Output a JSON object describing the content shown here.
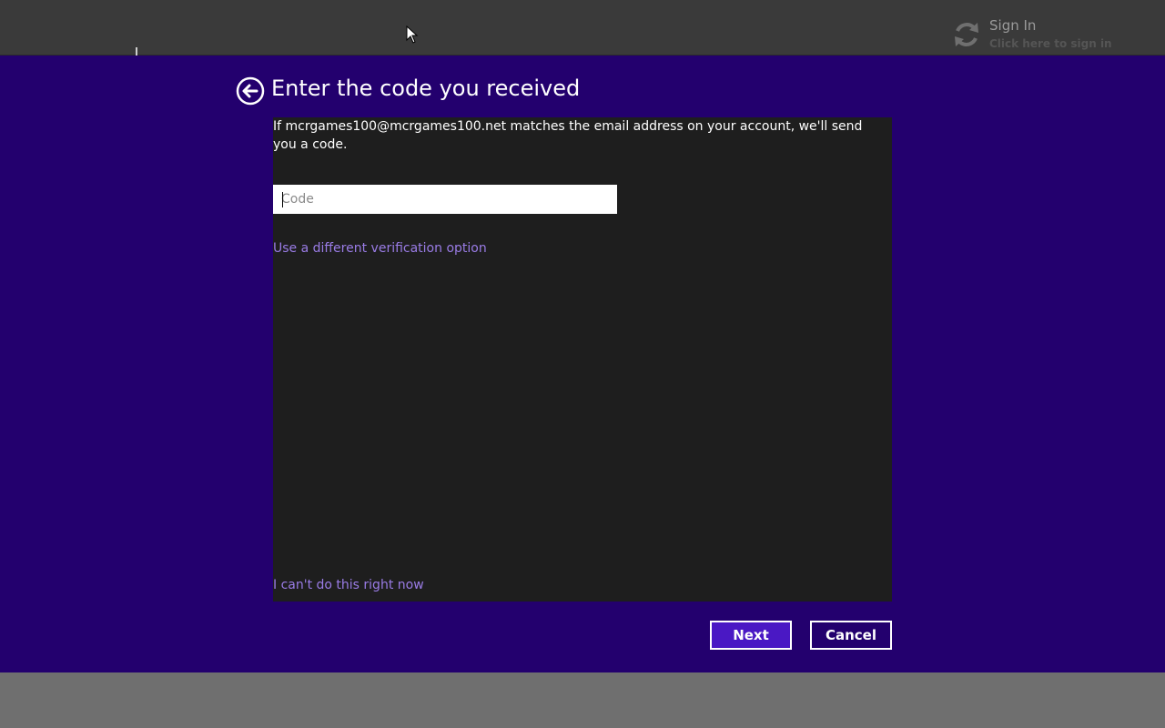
{
  "topbar": {
    "signin_title": "Sign In",
    "signin_subtitle": "Click here to sign in",
    "signin_icon": "sync-icon"
  },
  "dialog": {
    "title": "Enter the code you received",
    "back_icon": "back-arrow-icon",
    "description": "If mcrgames100@mcrgames100.net matches the email address on your account, we'll send you a code.",
    "code_input": {
      "placeholder": "Code",
      "value": ""
    },
    "different_option_link": "Use a different verification option",
    "cant_do_link": "I can't do this right now",
    "next_label": "Next",
    "cancel_label": "Cancel"
  },
  "colors": {
    "dialog_background": "#23006e",
    "panel_background": "#1e1e1e",
    "link": "#9a7ce6",
    "primary_button": "#4a18c4"
  }
}
